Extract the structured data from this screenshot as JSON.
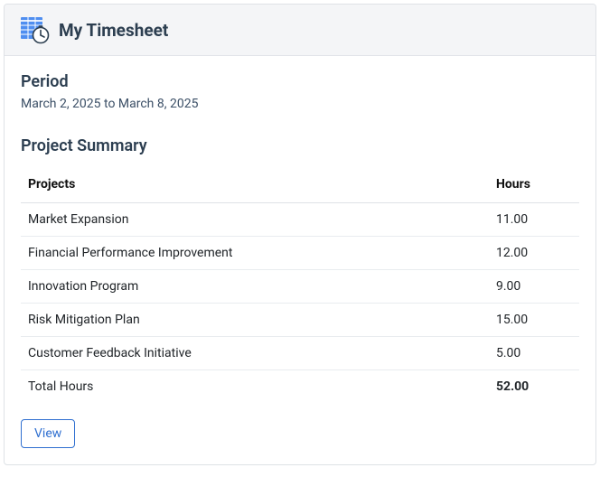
{
  "header": {
    "title": "My Timesheet"
  },
  "period": {
    "label": "Period",
    "range": "March 2, 2025 to March 8, 2025"
  },
  "summary": {
    "title": "Project Summary",
    "columns": {
      "projects": "Projects",
      "hours": "Hours"
    },
    "rows": [
      {
        "project": "Market Expansion",
        "hours": "11.00"
      },
      {
        "project": "Financial Performance Improvement",
        "hours": "12.00"
      },
      {
        "project": "Innovation Program",
        "hours": "9.00"
      },
      {
        "project": "Risk Mitigation Plan",
        "hours": "15.00"
      },
      {
        "project": "Customer Feedback Initiative",
        "hours": "5.00"
      }
    ],
    "total": {
      "label": "Total Hours",
      "value": "52.00"
    }
  },
  "actions": {
    "view": "View"
  },
  "colors": {
    "accent": "#2f6fd0",
    "heading": "#2c3e50"
  }
}
